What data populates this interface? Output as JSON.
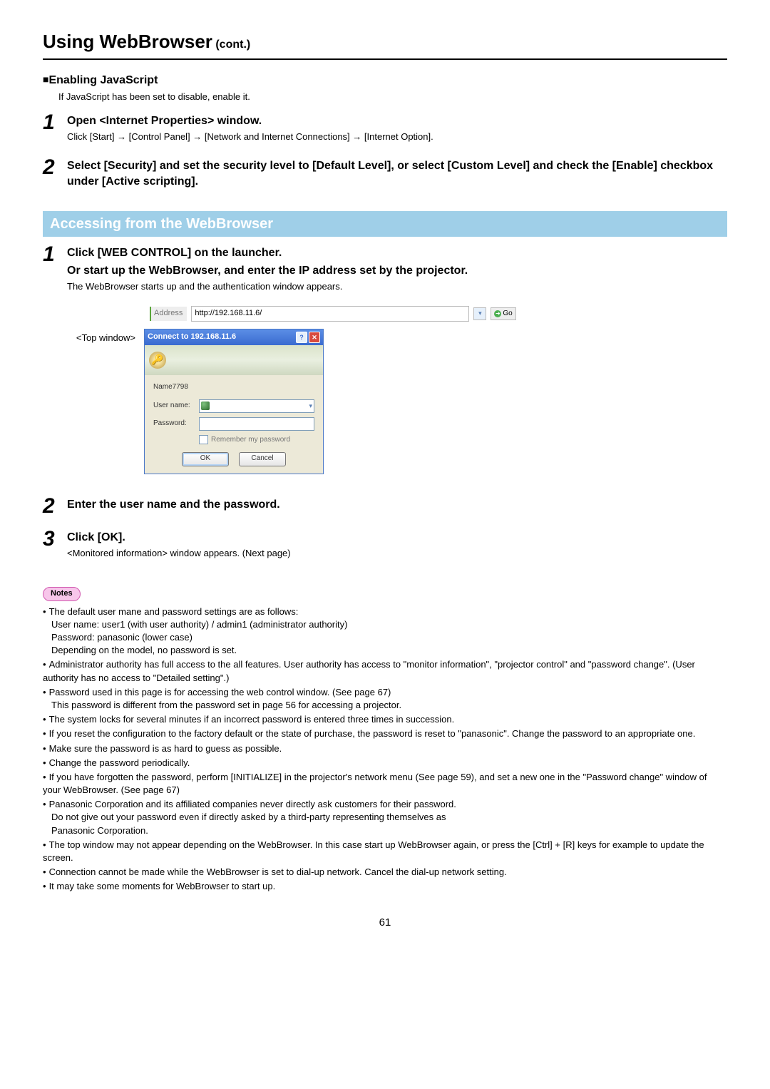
{
  "page_title_main": "Using WebBrowser",
  "page_title_cont": " (cont.)",
  "enable_js": {
    "heading": "Enabling JavaScript",
    "desc": "If JavaScript has been set to disable, enable it."
  },
  "step_js_1": {
    "num": "1",
    "title": "Open <Internet Properties> window.",
    "desc": "Click [Start] → [Control Panel] → [Network and Internet Connections] → [Internet Option]."
  },
  "step_js_2": {
    "num": "2",
    "title": "Select [Security] and set the security level to [Default Level], or select [Custom Level] and check the [Enable] checkbox under [Active scripting]."
  },
  "section_bar": "Accessing from the WebBrowser",
  "step_wb_1": {
    "num": "1",
    "title_line1": "Click [WEB CONTROL] on the launcher.",
    "title_line2": "Or start up the WebBrowser, and enter the IP address set by the projector.",
    "desc": "The WebBrowser starts up and the authentication window appears."
  },
  "addr_bar": {
    "label": "Address",
    "value": "http://192.168.11.6/",
    "go": "Go"
  },
  "top_window_caption": "<Top window>",
  "dialog": {
    "title": "Connect to 192.168.11.6",
    "realm": "Name7798",
    "user_label": "User name:",
    "pass_label": "Password:",
    "remember": "Remember my password",
    "ok": "OK",
    "cancel": "Cancel"
  },
  "step_wb_2": {
    "num": "2",
    "title": "Enter the user name and the password."
  },
  "step_wb_3": {
    "num": "3",
    "title": "Click [OK].",
    "desc": "<Monitored information> window appears. (Next page)"
  },
  "notes_label": "Notes",
  "notes": [
    {
      "text": "The default user mane and password settings are as follows:",
      "sublines": [
        "User name: user1 (with user authority) / admin1 (administrator authority)",
        "Password: panasonic (lower case)",
        "Depending on the model, no password is set."
      ]
    },
    {
      "text": "Administrator authority has full access to the all features. User authority has access to \"monitor information\", \"projector control\" and \"password change\". (User authority has no access to \"Detailed setting\".)"
    },
    {
      "text": "Password used in this page is for accessing the web control window. (See page 67)",
      "sublines": [
        "This password is different from the password set in page 56 for accessing a projector."
      ]
    },
    {
      "text": "The system locks for several minutes if an incorrect password is entered three times in succession."
    },
    {
      "text": "If you reset the configuration to the factory default or the state of purchase, the password is reset to \"panasonic\". Change the password to an appropriate one."
    },
    {
      "text": "Make sure the password is as hard to guess as possible."
    },
    {
      "text": "Change the password periodically."
    },
    {
      "text": "If you have forgotten the password, perform [INITIALIZE] in the projector's network menu (See page 59), and set a new one in the \"Password change\" window of your WebBrowser. (See page 67)"
    },
    {
      "text": "Panasonic Corporation and its affiliated companies never directly ask customers for their password.",
      "sublines": [
        "Do not give out your password even if directly asked by a third-party representing themselves as",
        "Panasonic Corporation."
      ]
    },
    {
      "text": "The top window may not appear depending on the WebBrowser. In this case start up WebBrowser again, or press the [Ctrl] + [R] keys for example to update the screen."
    },
    {
      "text": "Connection cannot be made while the WebBrowser is set to dial-up network. Cancel the dial-up network setting."
    },
    {
      "text": "It may take some moments for WebBrowser to start up."
    }
  ],
  "page_number": "61"
}
